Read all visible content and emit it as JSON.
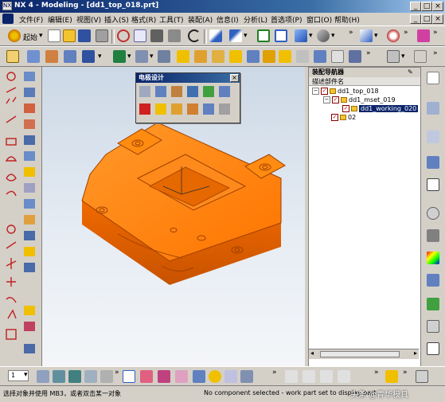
{
  "window": {
    "title": "NX 4 - Modeling - [dd1_top_018.prt]",
    "app_icon": "nx-app-icon",
    "controls": [
      "_",
      "□",
      "×"
    ],
    "doc_controls": [
      "_",
      "□",
      "×"
    ]
  },
  "menu": [
    "文件(F)",
    "编辑(E)",
    "视图(V)",
    "插入(S)",
    "格式(R)",
    "工具(T)",
    "装配(A)",
    "信息(I)",
    "分析(L)",
    "首选项(P)",
    "窗口(O)",
    "帮助(H)"
  ],
  "toolbar": {
    "start_label": "起始",
    "chevron": "»",
    "dropdown": "▾"
  },
  "electrode_dialog": {
    "title": "电极设计",
    "close": "×"
  },
  "navigator": {
    "title": "装配导航器",
    "column_header": "描述部件名",
    "tree": [
      {
        "label": "dd1_top_018",
        "toggle": "−",
        "checked": true
      },
      {
        "label": "dd1_mset_019",
        "toggle": "−",
        "checked": true
      },
      {
        "label": "dd1_working_020",
        "checked": true,
        "selected": true
      },
      {
        "label": "02",
        "checked": true
      }
    ]
  },
  "bottom": {
    "layer_value": "1"
  },
  "status": {
    "prompt": "选择对象并使用 MB3，或者双击某一对象",
    "message": "No component selected - work part set to display part"
  },
  "watermark": "头条 @青华模具",
  "colors": {
    "title_start": "#0a246a",
    "title_end": "#a6caf0",
    "part_orange": "#ff7b00",
    "selection_blue": "#0a246a"
  }
}
